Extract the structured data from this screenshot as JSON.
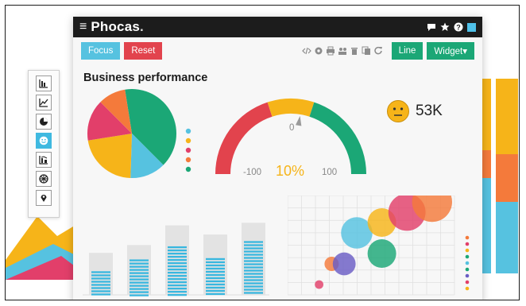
{
  "app": {
    "brand": "Phocas",
    "brand_dot": "."
  },
  "toolbar": {
    "focus_label": "Focus",
    "reset_label": "Reset",
    "line_label": "Line",
    "widget_label": "Widget▾"
  },
  "dashboard": {
    "title": "Business performance",
    "kpi": {
      "value": "53K",
      "icon": "neutral-face-icon"
    },
    "gauge": {
      "min_label": "-100",
      "zero_label": "0",
      "max_label": "100",
      "percent_label": "10%",
      "value_percent": 10,
      "colors": {
        "low": "#e2434d",
        "mid": "#f6b419",
        "high": "#1ba776"
      }
    }
  },
  "sidebar": {
    "items": [
      {
        "name": "bar-chart-icon"
      },
      {
        "name": "line-chart-icon"
      },
      {
        "name": "pie-chart-icon"
      },
      {
        "name": "smiley-icon",
        "active": true
      },
      {
        "name": "combo-chart-icon"
      },
      {
        "name": "globe-icon"
      },
      {
        "name": "map-pin-icon"
      }
    ]
  },
  "colors": {
    "accent": "#56c2e0",
    "danger": "#e2434d",
    "success": "#1ba776",
    "warning": "#f6b419",
    "pink": "#e23f6a",
    "orange": "#f47a3b",
    "titlebar": "#1c1c1c"
  },
  "chart_data": [
    {
      "type": "pie",
      "slices": [
        {
          "value": 40,
          "color": "#1ba776"
        },
        {
          "value": 13,
          "color": "#56c2e0"
        },
        {
          "value": 22,
          "color": "#f6b419"
        },
        {
          "value": 15,
          "color": "#e23f6a"
        },
        {
          "value": 10,
          "color": "#f47a3b"
        }
      ]
    },
    {
      "type": "bar",
      "values": [
        18,
        27,
        37,
        28,
        41
      ],
      "max": [
        32,
        38,
        53,
        46,
        55
      ]
    },
    {
      "type": "scatter",
      "points": [
        {
          "x": 2,
          "y": 1,
          "r": 3,
          "color": "#e23f6a"
        },
        {
          "x": 3,
          "y": 3,
          "r": 5,
          "color": "#f47a3b"
        },
        {
          "x": 4,
          "y": 3,
          "r": 8,
          "color": "#6a5dc4"
        },
        {
          "x": 5,
          "y": 6,
          "r": 11,
          "color": "#56c2e0"
        },
        {
          "x": 7,
          "y": 4,
          "r": 10,
          "color": "#1ba776"
        },
        {
          "x": 7,
          "y": 7,
          "r": 10,
          "color": "#f6b419"
        },
        {
          "x": 9,
          "y": 8,
          "r": 13,
          "color": "#e23f6a"
        },
        {
          "x": 11,
          "y": 9,
          "r": 14,
          "color": "#f47a3b"
        }
      ]
    }
  ]
}
